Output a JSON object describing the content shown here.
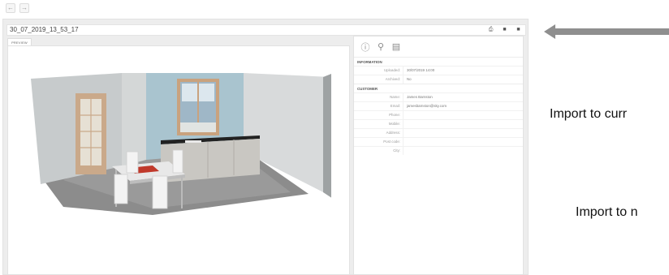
{
  "nav": {
    "back": "←",
    "forward": "→"
  },
  "window": {
    "title": "30_07_2019_13_53_17"
  },
  "preview": {
    "tab_label": "PREVIEW"
  },
  "info": {
    "sections": [
      {
        "heading": "INFORMATION",
        "rows": [
          {
            "label": "Uploaded:",
            "value": "30/07/2019 14:00"
          },
          {
            "label": "Archived:",
            "value": "No"
          }
        ]
      },
      {
        "heading": "CUSTOMER",
        "rows": [
          {
            "label": "Name:",
            "value": "James Barnston"
          },
          {
            "label": "Email:",
            "value": "jamesbarnston@sky.com"
          },
          {
            "label": "Phone:",
            "value": ""
          },
          {
            "label": "Mobile:",
            "value": ""
          },
          {
            "label": "Address:",
            "value": ""
          },
          {
            "label": "Post code:",
            "value": ""
          },
          {
            "label": "City:",
            "value": ""
          }
        ]
      }
    ]
  },
  "annotations": {
    "import_current": "Import to curr",
    "import_new": "Import to n"
  },
  "colors": {
    "window_bg": "#ededed",
    "wall_blue": "#a9c4cf",
    "arrow": "#8f8f8f"
  }
}
